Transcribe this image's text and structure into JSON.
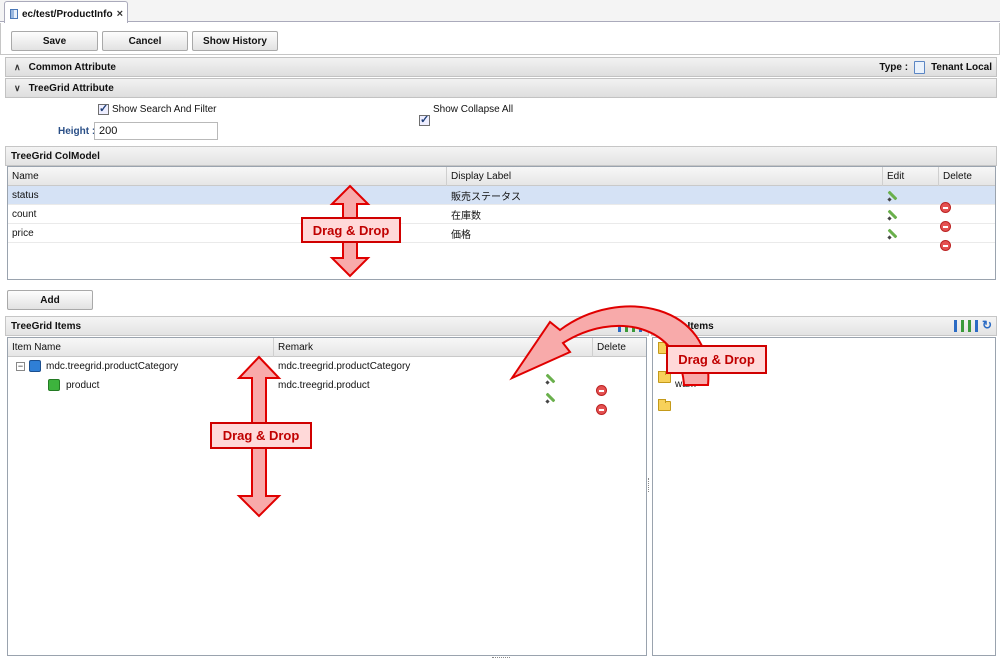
{
  "tab": {
    "title": "ec/test/ProductInfo",
    "close": "×"
  },
  "toolbar": {
    "save": "Save",
    "cancel": "Cancel",
    "history": "Show History"
  },
  "common": {
    "title": "Common Attribute",
    "type_label": "Type :",
    "type_value": "Tenant Local"
  },
  "treegrid_attr": {
    "title": "TreeGrid Attribute",
    "show_search": "Show Search And Filter",
    "show_collapse": "Show Collapse All",
    "height_label": "Height :",
    "height_value": "200"
  },
  "colmodel": {
    "title": "TreeGrid ColModel",
    "headers": {
      "name": "Name",
      "label": "Display Label",
      "edit": "Edit",
      "delete": "Delete"
    },
    "rows": [
      {
        "name": "status",
        "label": "販売ステータス"
      },
      {
        "name": "count",
        "label": "在庫数"
      },
      {
        "name": "price",
        "label": "価格"
      }
    ],
    "add": "Add"
  },
  "items": {
    "title": "TreeGrid Items",
    "headers": {
      "name": "Item Name",
      "remark": "Remark",
      "edit": "Edit",
      "delete": "Delete"
    },
    "rows": [
      {
        "name": "mdc.treegrid.productCategory",
        "remark": "mdc.treegrid.productCategory"
      },
      {
        "name": "product",
        "remark": "mdc.treegrid.product"
      }
    ]
  },
  "entity": {
    "title": "Entity Items",
    "nodes": [
      "",
      "",
      "wam"
    ]
  },
  "annotations": {
    "dd1": "Drag & Drop",
    "dd2": "Drag & Drop",
    "dd3": "Drag & Drop"
  },
  "colors": {
    "annot_red": "#d00000",
    "annot_fill": "#ffd9d9",
    "selected_row": "#d5e2f5"
  }
}
